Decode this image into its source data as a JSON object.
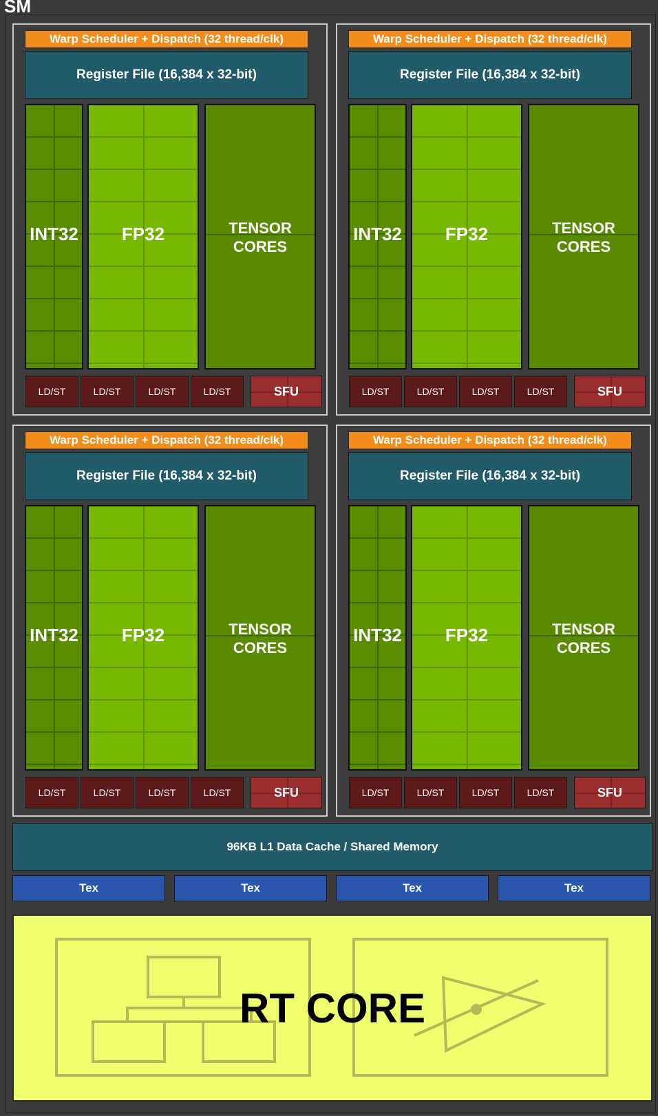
{
  "sm_title": "SM",
  "quadrants": [
    {
      "warp": "Warp Scheduler + Dispatch (32 thread/clk)",
      "register_file": "Register File (16,384 x 32-bit)",
      "int32": "INT32",
      "fp32": "FP32",
      "tensor_line1": "TENSOR",
      "tensor_line2": "CORES",
      "ldst": [
        "LD/ST",
        "LD/ST",
        "LD/ST",
        "LD/ST"
      ],
      "sfu": "SFU"
    },
    {
      "warp": "Warp Scheduler + Dispatch (32 thread/clk)",
      "register_file": "Register File (16,384 x 32-bit)",
      "int32": "INT32",
      "fp32": "FP32",
      "tensor_line1": "TENSOR",
      "tensor_line2": "CORES",
      "ldst": [
        "LD/ST",
        "LD/ST",
        "LD/ST",
        "LD/ST"
      ],
      "sfu": "SFU"
    },
    {
      "warp": "Warp Scheduler + Dispatch (32 thread/clk)",
      "register_file": "Register File (16,384 x 32-bit)",
      "int32": "INT32",
      "fp32": "FP32",
      "tensor_line1": "TENSOR",
      "tensor_line2": "CORES",
      "ldst": [
        "LD/ST",
        "LD/ST",
        "LD/ST",
        "LD/ST"
      ],
      "sfu": "SFU"
    },
    {
      "warp": "Warp Scheduler + Dispatch (32 thread/clk)",
      "register_file": "Register File (16,384 x 32-bit)",
      "int32": "INT32",
      "fp32": "FP32",
      "tensor_line1": "TENSOR",
      "tensor_line2": "CORES",
      "ldst": [
        "LD/ST",
        "LD/ST",
        "LD/ST",
        "LD/ST"
      ],
      "sfu": "SFU"
    }
  ],
  "l1_cache": "96KB L1 Data Cache / Shared Memory",
  "tex": [
    "Tex",
    "Tex",
    "Tex",
    "Tex"
  ],
  "rt_core": "RT CORE",
  "colors": {
    "warp": "#f28c1b",
    "register_file": "#215a68",
    "int32": "#5a8c00",
    "fp32": "#76b900",
    "tensor": "#5a8a00",
    "ldst": "#5c1a1a",
    "sfu": "#9a2e2e",
    "tex": "#2a55ad",
    "rt_core": "#f0ff6e"
  },
  "icons": [
    "bvh-tree-icon",
    "ray-triangle-intersection-icon"
  ]
}
